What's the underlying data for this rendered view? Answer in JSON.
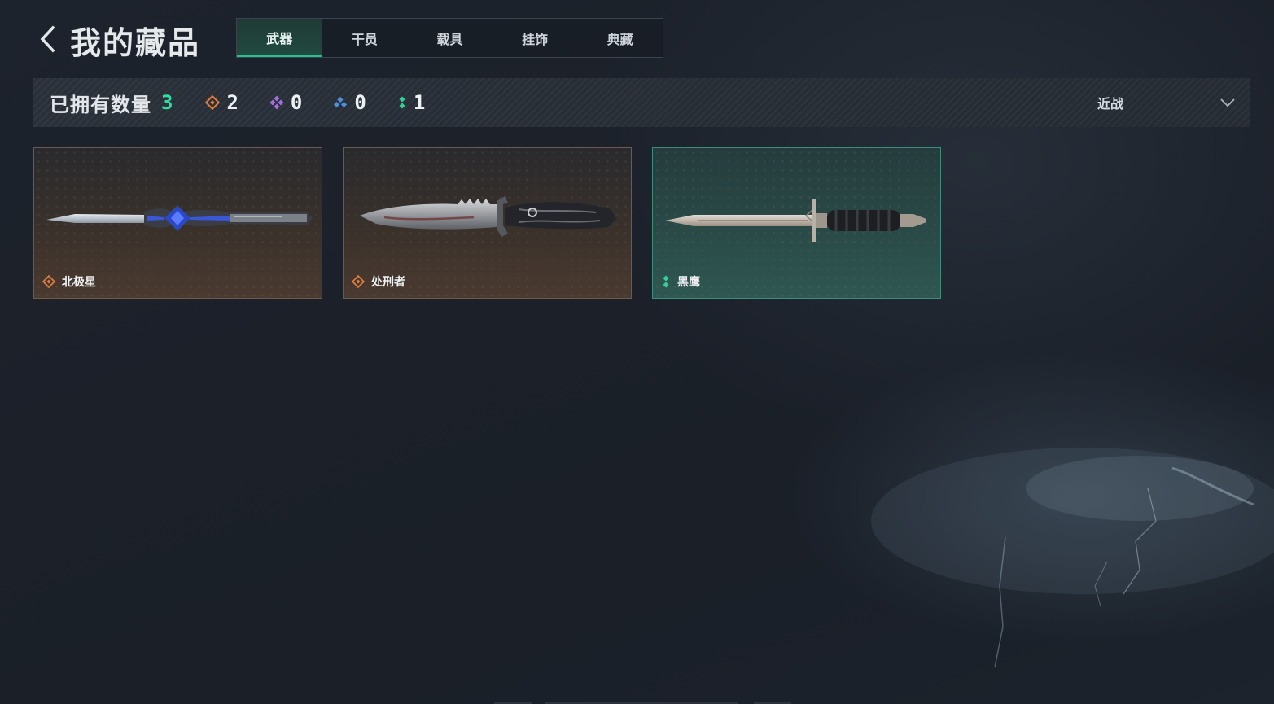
{
  "header": {
    "back_icon": "chevron-left-icon",
    "title": "我的藏品"
  },
  "tabs": [
    {
      "label": "武器",
      "active": true
    },
    {
      "label": "干员",
      "active": false
    },
    {
      "label": "载具",
      "active": false
    },
    {
      "label": "挂饰",
      "active": false
    },
    {
      "label": "典藏",
      "active": false
    }
  ],
  "owned": {
    "label": "已拥有数量",
    "count": "3",
    "count_color": "#2fe0a0",
    "rarities": [
      {
        "icon": "orange-diamond-icon",
        "color": "#e07d3c",
        "count": "2"
      },
      {
        "icon": "purple-diamond-icon",
        "color": "#a66de0",
        "count": "0"
      },
      {
        "icon": "blue-diamond-icon",
        "color": "#4f8fe0",
        "count": "0"
      },
      {
        "icon": "green-dots-icon",
        "color": "#2fd39a",
        "count": "1"
      }
    ],
    "filter": {
      "label": "近战",
      "icon": "chevron-down-icon"
    }
  },
  "items": [
    {
      "name": "北极星",
      "rarity": "orange",
      "rarity_icon": "orange-diamond-icon",
      "weapon_icon": "blue-knife-icon"
    },
    {
      "name": "处刑者",
      "rarity": "orange",
      "rarity_icon": "orange-diamond-icon",
      "weapon_icon": "serrated-knife-icon"
    },
    {
      "name": "黑鹰",
      "rarity": "green",
      "rarity_icon": "green-dots-icon",
      "weapon_icon": "dagger-icon"
    }
  ]
}
